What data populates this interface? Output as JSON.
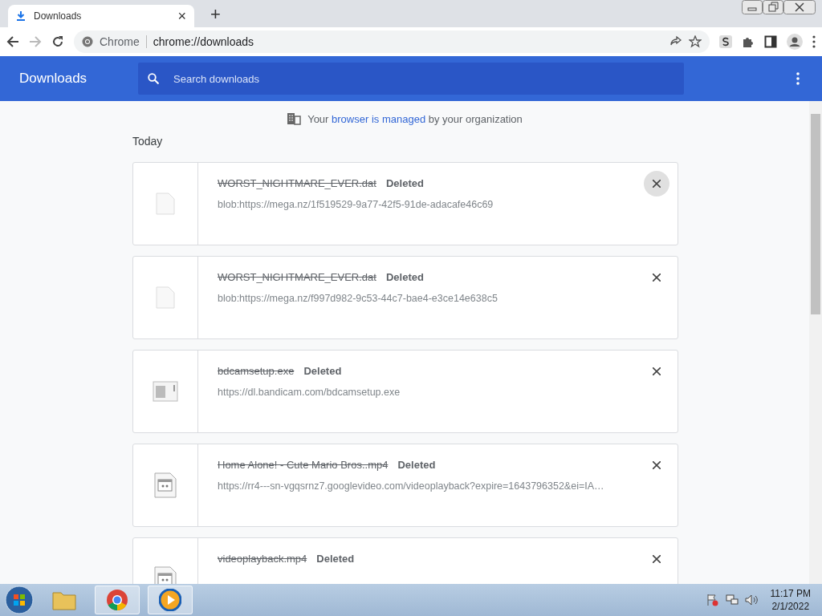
{
  "tab": {
    "title": "Downloads",
    "close": "×",
    "new_tab": "+"
  },
  "toolbar": {
    "site_label": "Chrome",
    "url": "chrome://downloads"
  },
  "header": {
    "title": "Downloads",
    "search_placeholder": "Search downloads"
  },
  "managed_notice": {
    "before": "Your",
    "link": "browser is managed",
    "after": "by your organization"
  },
  "section": "Today",
  "downloads": [
    {
      "name": "WORST_NIGHTMARE_EVER.dat",
      "status": "Deleted",
      "url": "blob:https://mega.nz/1f519529-9a77-42f5-91de-adacafe46c69",
      "kind": "blank",
      "hovered": true
    },
    {
      "name": "WORST_NIGHTMARE_EVER.dat",
      "status": "Deleted",
      "url": "blob:https://mega.nz/f997d982-9c53-44c7-bae4-e3ce14e638c5",
      "kind": "blank",
      "hovered": false
    },
    {
      "name": "bdcamsetup.exe",
      "status": "Deleted",
      "url": "https://dl.bandicam.com/bdcamsetup.exe",
      "kind": "app",
      "hovered": false
    },
    {
      "name": "Home Alone! - Cute Mario Bros..mp4",
      "status": "Deleted",
      "url": "https://rr4---sn-vgqsrnz7.googlevideo.com/videoplayback?expire=1643796352&ei=IA…",
      "kind": "video",
      "hovered": false
    },
    {
      "name": "videoplayback.mp4",
      "status": "Deleted",
      "kind": "video",
      "hovered": false
    }
  ],
  "taskbar": {
    "time": "11:17 PM",
    "date": "2/1/2022"
  }
}
